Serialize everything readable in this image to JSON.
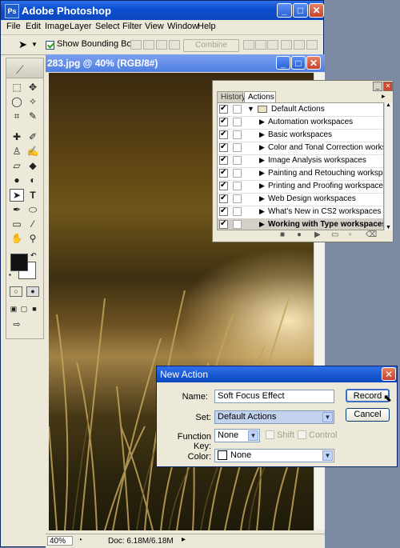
{
  "app": {
    "title": "Adobe Photoshop",
    "icon": "ps-icon"
  },
  "menu": [
    "File",
    "Edit",
    "Image",
    "Layer",
    "Select",
    "Filter",
    "View",
    "Window",
    "Help"
  ],
  "options": {
    "show_bounding_box_label": "Show Bounding Box",
    "show_bounding_box": true,
    "combine_label": "Combine"
  },
  "document": {
    "title": "283.jpg @ 40% (RGB/8#)",
    "zoom": "40%",
    "doc_size": "Doc: 6.18M/6.18M"
  },
  "panel": {
    "tabs": [
      "History",
      "Actions"
    ],
    "active_tab": "Actions",
    "set_name": "Default Actions",
    "actions": [
      "Automation workspaces",
      "Basic workspaces",
      "Color and Tonal Correction workspaces",
      "Image Analysis workspaces",
      "Painting and Retouching workspaces",
      "Printing and Proofing workspaces",
      "Web Design workspaces",
      "What's New in CS2 workspaces",
      "Working with Type workspaces"
    ],
    "selected_action": "Working with Type workspaces"
  },
  "dialog": {
    "title": "New Action",
    "name_label": "Name:",
    "name_value": "Soft Focus Effect",
    "set_label": "Set:",
    "set_value": "Default Actions",
    "fkey_label": "Function Key:",
    "fkey_value": "None",
    "shift_label": "Shift",
    "control_label": "Control",
    "color_label": "Color:",
    "color_value": "None",
    "record_label": "Record",
    "cancel_label": "Cancel"
  },
  "colors": {
    "titlebar": "#0b48c0",
    "accent_close": "#c8412a"
  }
}
